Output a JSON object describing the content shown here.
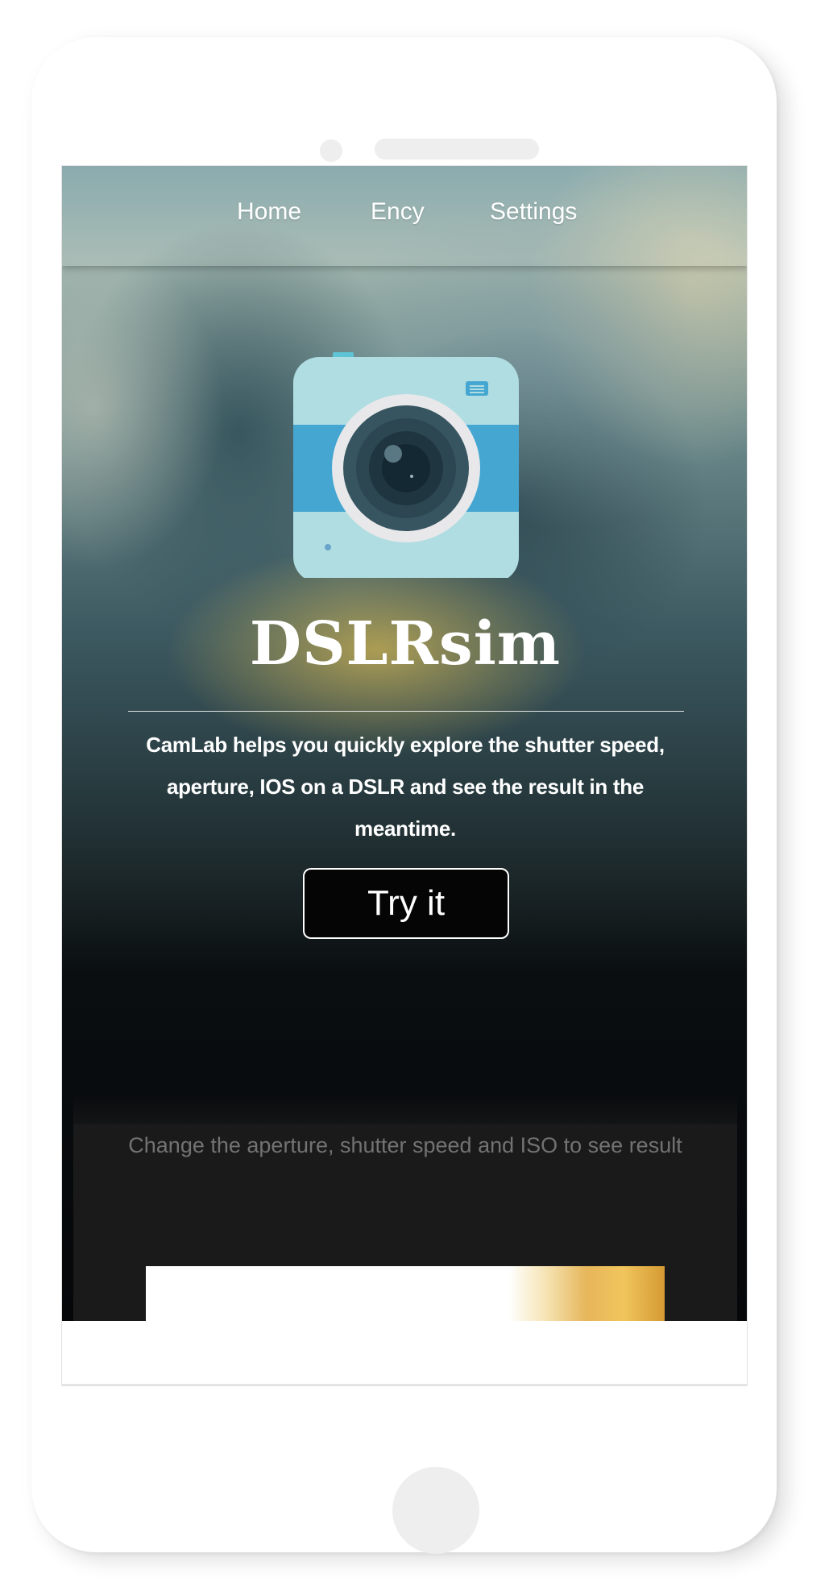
{
  "nav": {
    "items": [
      {
        "label": "Home"
      },
      {
        "label": "Ency"
      },
      {
        "label": "Settings"
      }
    ]
  },
  "hero": {
    "logo_icon": "camera-icon",
    "title": "DSLRsim",
    "tagline": "CamLab helps you quickly explore the shutter speed, aperture, IOS on a DSLR and see the result in the meantime.",
    "cta_label": "Try it"
  },
  "simulator": {
    "instruction": "Change the aperture, shutter speed and ISO to see result"
  },
  "colors": {
    "camera_body": "#b0dde2",
    "camera_band": "#44a6d1",
    "lens_ring": "#e8e8ea",
    "lens_dark": "#2c4652",
    "section_bg": "#1a1a1a",
    "instruction_text": "#727272"
  }
}
